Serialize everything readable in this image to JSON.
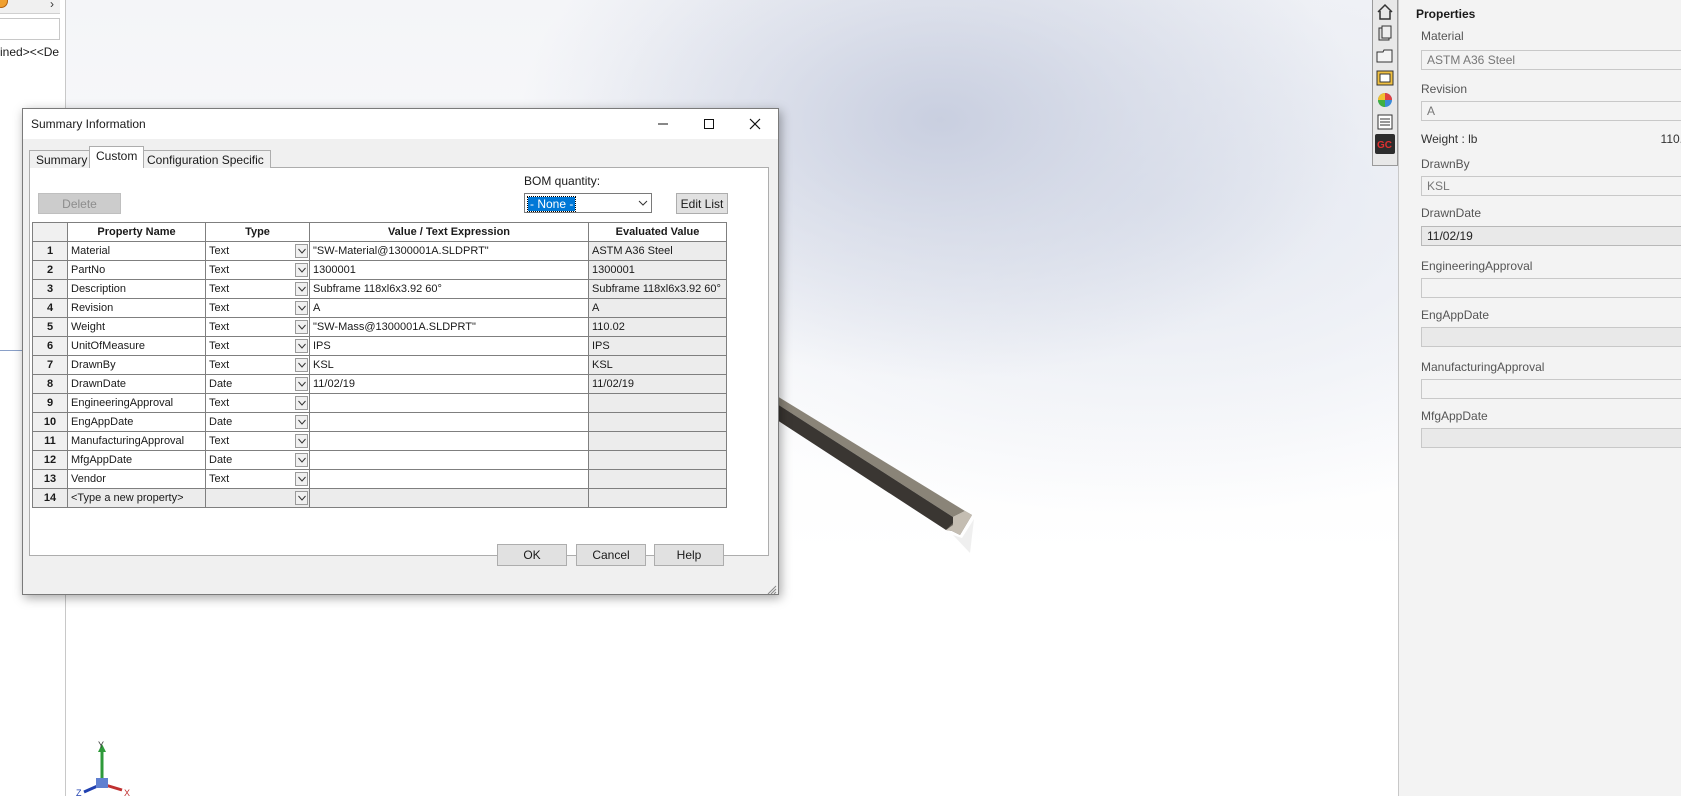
{
  "left_tree": {
    "node_text": "ined><<De"
  },
  "dialog": {
    "title": "Summary Information",
    "tabs": [
      "Summary",
      "Custom",
      "Configuration Specific"
    ],
    "delete_label": "Delete",
    "bom_label": "BOM quantity:",
    "bom_value": "- None -",
    "edit_list_label": "Edit List",
    "columns": [
      "Property Name",
      "Type",
      "Value / Text Expression",
      "Evaluated Value"
    ],
    "rows": [
      {
        "n": "1",
        "name": "Material",
        "type": "Text",
        "value": "\"SW-Material@1300001A.SLDPRT\"",
        "eval": "ASTM A36 Steel"
      },
      {
        "n": "2",
        "name": "PartNo",
        "type": "Text",
        "value": "1300001",
        "eval": "1300001"
      },
      {
        "n": "3",
        "name": "Description",
        "type": "Text",
        "value": "Subframe 118xl6x3.92 60°",
        "eval": "Subframe 118xl6x3.92 60°"
      },
      {
        "n": "4",
        "name": "Revision",
        "type": "Text",
        "value": "A",
        "eval": "A"
      },
      {
        "n": "5",
        "name": "Weight",
        "type": "Text",
        "value": "\"SW-Mass@1300001A.SLDPRT\"",
        "eval": "110.02"
      },
      {
        "n": "6",
        "name": "UnitOfMeasure",
        "type": "Text",
        "value": "IPS",
        "eval": "IPS"
      },
      {
        "n": "7",
        "name": "DrawnBy",
        "type": "Text",
        "value": "KSL",
        "eval": "KSL"
      },
      {
        "n": "8",
        "name": "DrawnDate",
        "type": "Date",
        "value": "11/02/19",
        "eval": "11/02/19"
      },
      {
        "n": "9",
        "name": "EngineeringApproval",
        "type": "Text",
        "value": "",
        "eval": ""
      },
      {
        "n": "10",
        "name": "EngAppDate",
        "type": "Date",
        "value": "",
        "eval": ""
      },
      {
        "n": "11",
        "name": "ManufacturingApproval",
        "type": "Text",
        "value": "",
        "eval": ""
      },
      {
        "n": "12",
        "name": "MfgAppDate",
        "type": "Date",
        "value": "",
        "eval": ""
      },
      {
        "n": "13",
        "name": "Vendor",
        "type": "Text",
        "value": "",
        "eval": ""
      },
      {
        "n": "14",
        "name": "<Type a new property>",
        "type": "",
        "value": "",
        "eval": ""
      }
    ],
    "ok_label": "OK",
    "cancel_label": "Cancel",
    "help_label": "Help"
  },
  "properties_panel": {
    "title": "Properties",
    "material_label": "Material",
    "material_value": "ASTM A36 Steel",
    "revision_label": "Revision",
    "revision_value": "A",
    "weight_label": "Weight : lb",
    "weight_value": "110.",
    "drawnby_label": "DrawnBy",
    "drawnby_value": "KSL",
    "drawndate_label": "DrawnDate",
    "drawndate_value": "11/02/19",
    "engapproval_label": "EngineeringApproval",
    "engappdate_label": "EngAppDate",
    "mfgapproval_label": "ManufacturingApproval",
    "mfgappdate_label": "MfgAppDate"
  },
  "triad": {
    "y": "Y",
    "x": "X",
    "z": "Z"
  },
  "icons": [
    "home-icon",
    "parts-icon",
    "folder-icon",
    "view-palette-icon",
    "appearance-icon",
    "custom-properties-icon",
    "gc-icon"
  ],
  "colors": {
    "selection": "#0078d7",
    "dialog_bg": "#f0f0f0",
    "beam_dark": "#3a3632",
    "beam_light": "#8a8478"
  }
}
